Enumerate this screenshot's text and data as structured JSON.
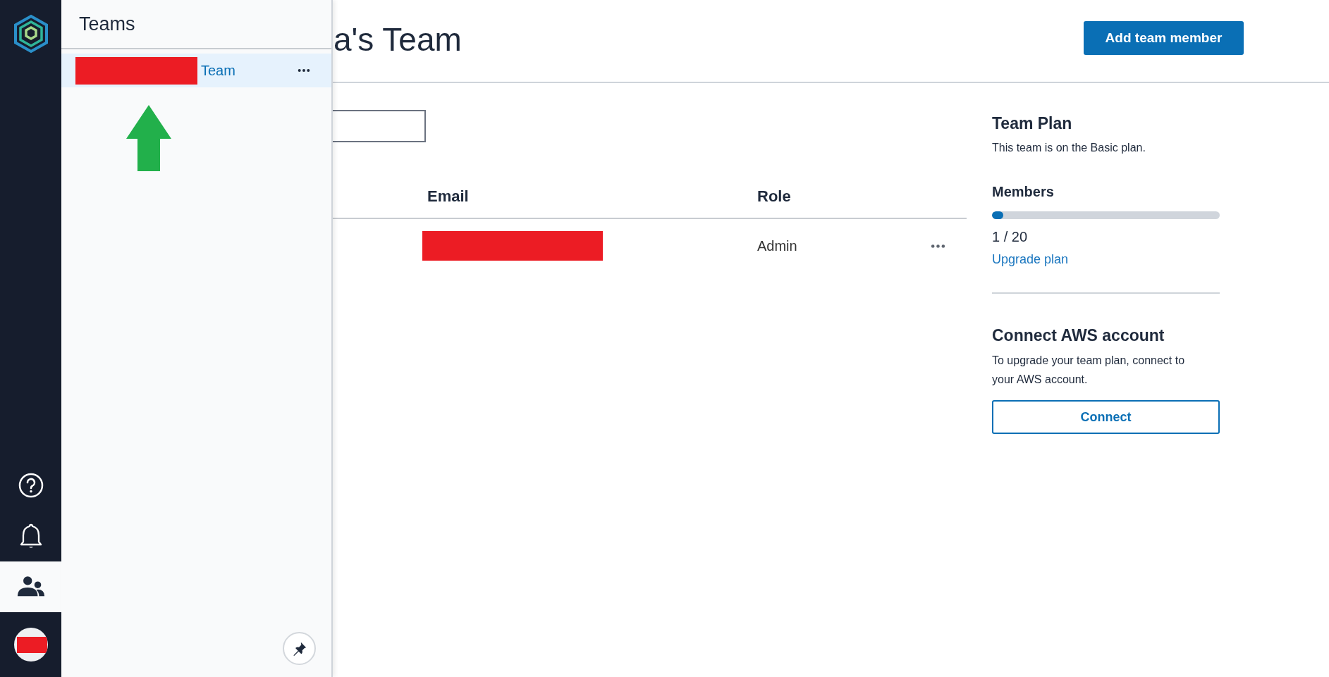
{
  "rail": {
    "items": [
      {
        "kind": "help",
        "selected": false
      },
      {
        "kind": "notifications",
        "selected": false
      },
      {
        "kind": "teams",
        "selected": true
      }
    ],
    "avatar": {
      "redacted": true
    }
  },
  "flyout": {
    "title": "Teams",
    "teams": [
      {
        "name": "Team",
        "redacted": true,
        "selected": true
      }
    ]
  },
  "page": {
    "title": "a's Team",
    "add_button": "Add team member",
    "table": {
      "columns": [
        "Email",
        "Role"
      ],
      "rows": [
        {
          "email_redacted": true,
          "role": "Admin"
        }
      ]
    }
  },
  "plan": {
    "title": "Team Plan",
    "text": "This team is on the Basic plan.",
    "members_label": "Members",
    "level": 0.05,
    "count": "1 / 20",
    "upgrade_link": "Upgrade plan"
  },
  "aws": {
    "title": "Connect AWS account",
    "text": "To upgrade your team plan, connect to your AWS account.",
    "button": "Connect"
  }
}
